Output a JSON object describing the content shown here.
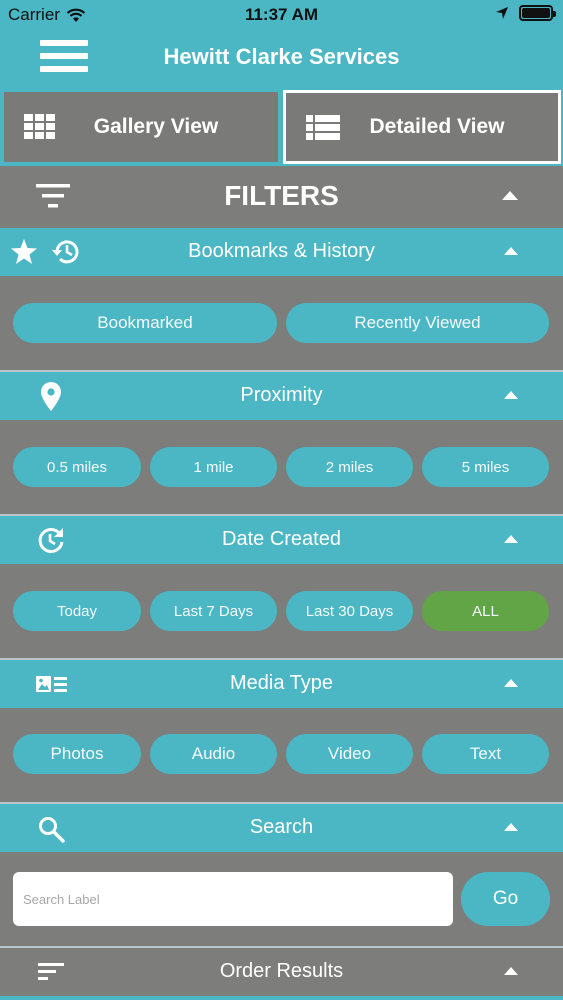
{
  "status_bar": {
    "carrier": "Carrier",
    "time": "11:37 AM"
  },
  "header": {
    "title": "Hewitt Clarke Services"
  },
  "views": {
    "gallery": "Gallery View",
    "detailed": "Detailed View"
  },
  "filters": {
    "title": "FILTERS"
  },
  "sections": {
    "bookmarks": {
      "title": "Bookmarks & History",
      "options": [
        "Bookmarked",
        "Recently Viewed"
      ]
    },
    "proximity": {
      "title": "Proximity",
      "options": [
        "0.5 miles",
        "1 mile",
        "2 miles",
        "5 miles"
      ]
    },
    "date_created": {
      "title": "Date Created",
      "options": [
        "Today",
        "Last 7 Days",
        "Last 30 Days",
        "ALL"
      ],
      "selected": "ALL"
    },
    "media_type": {
      "title": "Media Type",
      "options": [
        "Photos",
        "Audio",
        "Video",
        "Text"
      ]
    },
    "search": {
      "title": "Search",
      "placeholder": "Search Label",
      "value": "",
      "go_label": "Go"
    },
    "order_results": {
      "title": "Order Results"
    }
  },
  "colors": {
    "accent": "#4bb6c4",
    "background": "#7d7d7b",
    "selected": "#62a546"
  },
  "icons": [
    "wifi-icon",
    "location-arrow-icon",
    "battery-icon",
    "menu-icon",
    "grid-icon",
    "list-icon",
    "filter-icon",
    "star-icon",
    "history-icon",
    "map-pin-icon",
    "refresh-clock-icon",
    "media-icon",
    "search-icon",
    "sort-icon",
    "chevron-up-icon"
  ]
}
